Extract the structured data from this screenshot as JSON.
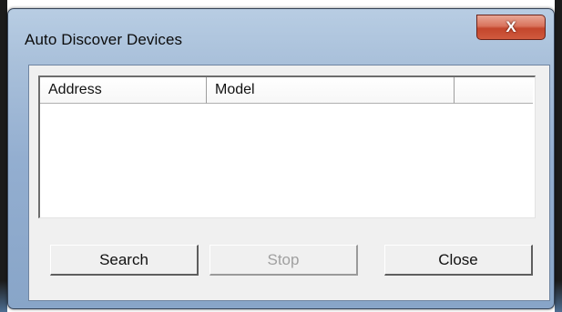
{
  "window": {
    "title": "Auto Discover Devices",
    "close_glyph": "X"
  },
  "device_list": {
    "columns": [
      "Address",
      "Model",
      ""
    ],
    "rows": []
  },
  "buttons": {
    "search": "Search",
    "stop": "Stop",
    "close": "Close"
  }
}
